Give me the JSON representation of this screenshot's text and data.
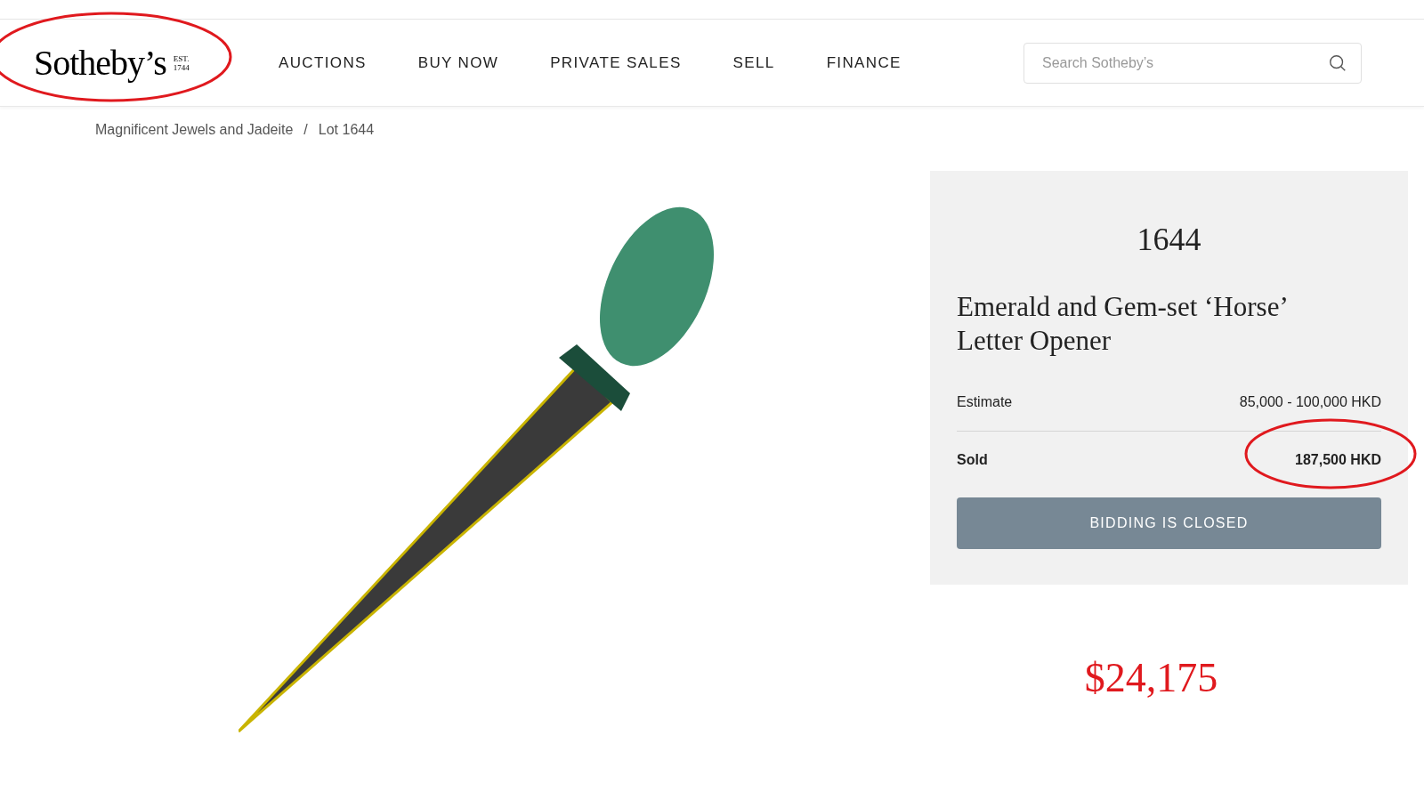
{
  "header": {
    "logo": "Sotheby’s",
    "logo_badge": "EST. 1744",
    "nav": [
      {
        "label": "AUCTIONS"
      },
      {
        "label": "BUY NOW"
      },
      {
        "label": "PRIVATE SALES"
      },
      {
        "label": "SELL"
      },
      {
        "label": "FINANCE"
      }
    ],
    "search": {
      "placeholder": "Search Sotheby’s"
    }
  },
  "breadcrumb": {
    "items": [
      "Magnificent Jewels and Jadeite",
      "Lot 1644"
    ],
    "separator": "/"
  },
  "lot": {
    "number": "1644",
    "title": "Emerald and Gem-set ‘Horse’ Letter Opener",
    "estimate": {
      "label": "Estimate",
      "value": "85,000 - 100,000 HKD"
    },
    "sold": {
      "label": "Sold",
      "value": "187,500 HKD"
    },
    "button": "BIDDING IS CLOSED"
  },
  "annotation": {
    "price_note": "$24,175"
  }
}
